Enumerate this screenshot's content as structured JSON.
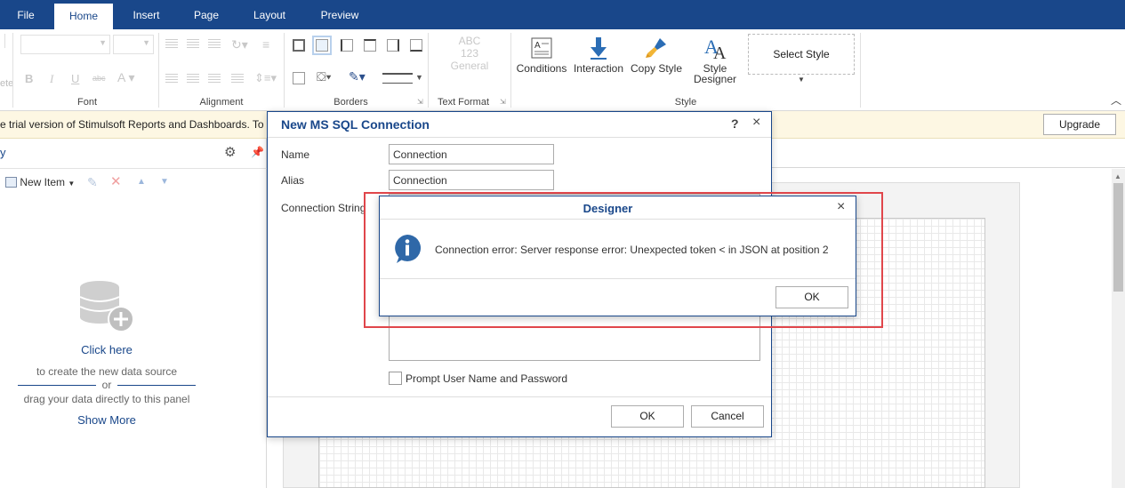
{
  "menu": {
    "tabs": [
      {
        "label": "File"
      },
      {
        "label": "Home"
      },
      {
        "label": "Insert"
      },
      {
        "label": "Page"
      },
      {
        "label": "Layout"
      },
      {
        "label": "Preview"
      }
    ],
    "active_tab": "Home"
  },
  "ribbon": {
    "groups": {
      "font": "Font",
      "alignment": "Alignment",
      "borders": "Borders",
      "text_format": "Text Format",
      "style": "Style"
    },
    "paste_fragment": "ete",
    "text_format_preview": {
      "line1": "ABC",
      "line2": "123",
      "line3": "General"
    },
    "buttons": {
      "conditions": "Conditions",
      "interaction": "Interaction",
      "copy_style": "Copy Style",
      "style_designer_line1": "Style",
      "style_designer_line2": "Designer",
      "select_style": "Select Style"
    }
  },
  "trial": {
    "text": "e trial version of Stimulsoft Reports and Dashboards. To",
    "upgrade_label": "Upgrade"
  },
  "dictionary_panel": {
    "title_fragment": "y",
    "new_item_label": "New Item",
    "click_here": "Click here",
    "hint_create": "to create the new data source",
    "or": "or",
    "hint_drag": "drag your data directly to this panel",
    "show_more": "Show More"
  },
  "sql_dialog": {
    "title": "New MS SQL Connection",
    "help": "?",
    "close": "×",
    "name_label": "Name",
    "name_value": "Connection",
    "alias_label": "Alias",
    "alias_value": "Connection",
    "connection_string_label": "Connection String",
    "prompt_label": "Prompt User Name and Password",
    "ok_label": "OK",
    "cancel_label": "Cancel"
  },
  "message_dialog": {
    "title": "Designer",
    "close": "×",
    "message": "Connection error: Server response error: Unexpected token < in JSON at position 2",
    "ok_label": "OK",
    "icon": "info-icon"
  },
  "colors": {
    "brand_blue": "#19478a",
    "trial_bg": "#fdf7e3",
    "highlight_red": "#e0464b"
  }
}
